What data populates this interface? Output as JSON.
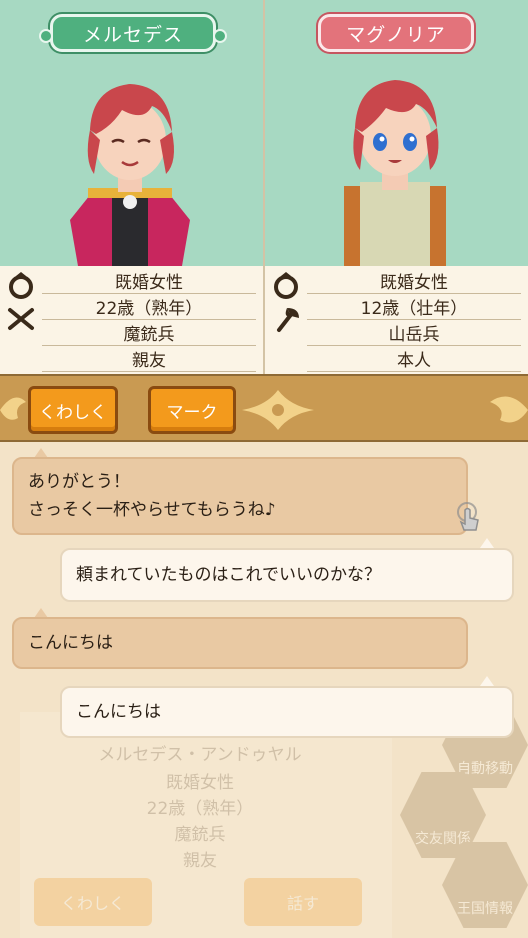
{
  "left_character": {
    "name": "メルセデス",
    "marital": "既婚女性",
    "age": "22歳（熟年）",
    "job": "魔銃兵",
    "relation": "親友"
  },
  "right_character": {
    "name": "マグノリア",
    "marital": "既婚女性",
    "age": "12歳（壮年）",
    "job": "山岳兵",
    "relation": "本人"
  },
  "buttons": {
    "detail": "くわしく",
    "mark": "マーク"
  },
  "dialogue": {
    "line1": "ありがとう！",
    "line2": "さっそく一杯やらせてもらうね♪",
    "line3": "頼まれていたものはこれでいいのかな？",
    "line4": "こんにちは",
    "line5": "こんにちは"
  },
  "background_panel": {
    "full_name": "メルセデス・アンドゥヤル",
    "marital": "既婚女性",
    "age": "22歳（熟年）",
    "job": "魔銃兵",
    "relation": "親友",
    "detail_btn": "くわしく",
    "talk_btn": "話す"
  },
  "side_menu": {
    "auto_move": "自動移動",
    "friendship": "交友関係",
    "kingdom_info": "王国情報"
  },
  "colors": {
    "panel_bg": "#a7d9c2",
    "green_tag": "#4fb07f",
    "red_tag": "#e3737b",
    "orange_button": "#f39a1c",
    "tan_bubble": "#e9c9a3",
    "white_bubble": "#fdf6ec"
  },
  "icons": [
    "ring-icon",
    "crossed-guns-icon",
    "axe-icon",
    "tap-hand-icon"
  ]
}
